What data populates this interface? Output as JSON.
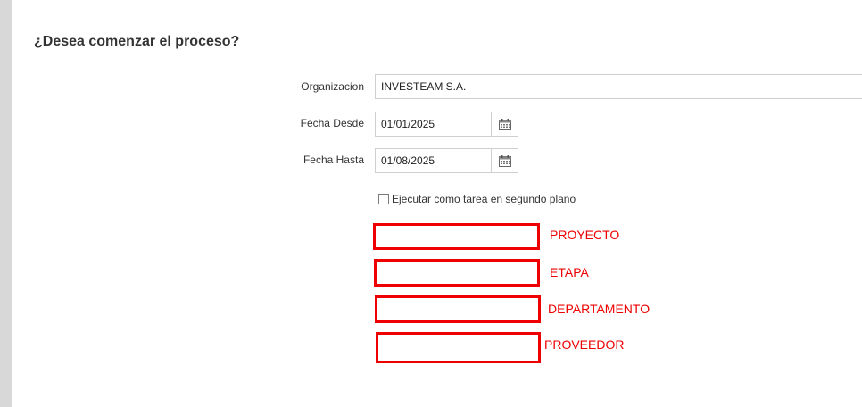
{
  "form": {
    "title": "¿Desea comenzar el proceso?",
    "organizacion": {
      "label": "Organizacion",
      "value": "INVESTEAM S.A."
    },
    "fecha_desde": {
      "label": "Fecha Desde",
      "value": "01/01/2025"
    },
    "fecha_hasta": {
      "label": "Fecha Hasta",
      "value": "01/08/2025"
    },
    "background_task": {
      "label": "Ejecutar como tarea en segundo plano",
      "checked": false
    }
  },
  "annotations": [
    {
      "label": "PROYECTO"
    },
    {
      "label": "ETAPA"
    },
    {
      "label": "DEPARTAMENTO"
    },
    {
      "label": "PROVEEDOR"
    }
  ],
  "colors": {
    "annotation": "#ee0000",
    "border": "#cfcfcf",
    "gutter": "#d8d8d8"
  },
  "icons": {
    "calendar": "calendar-icon"
  }
}
